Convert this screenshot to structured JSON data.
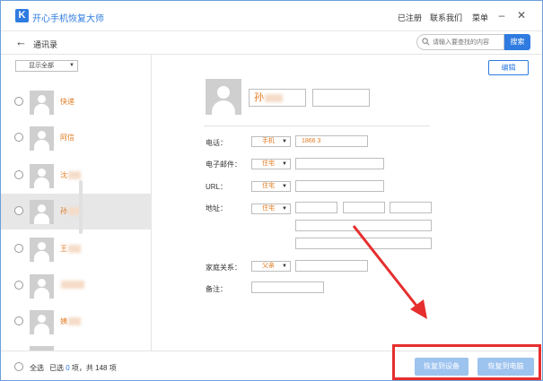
{
  "window": {
    "title": "开心手机恢复大师",
    "logo_letter": "K",
    "links": [
      "已注册",
      "联系我们",
      "菜单"
    ],
    "minimize": "–",
    "close": "✕"
  },
  "toolbar": {
    "back_icon": "←",
    "page_name": "通讯录",
    "search_placeholder": "请输入要查找的内容",
    "search_button": "搜索"
  },
  "left": {
    "filter": "显示全部",
    "contacts": [
      {
        "name": "快递",
        "selected": false
      },
      {
        "name": "阿信",
        "selected": false
      },
      {
        "name": "沈",
        "selected": false
      },
      {
        "name": "孙",
        "selected": true
      },
      {
        "name": "王",
        "selected": false
      },
      {
        "name": "",
        "selected": false
      },
      {
        "name": "姨",
        "selected": false
      }
    ]
  },
  "detail": {
    "edit_button": "编辑",
    "first_name": "孙",
    "phone_label": "电话：",
    "phone_type": "手机",
    "phone_value": "1866    3",
    "email_label": "电子邮件：",
    "email_type": "住宅",
    "url_label": "URL：",
    "url_type": "住宅",
    "address_label": "地址：",
    "address_type": "住宅",
    "family_label": "家庭关系：",
    "family_type": "父亲",
    "note_label": "备注："
  },
  "bottom": {
    "select_all": "全选",
    "selected_prefix": "已选",
    "selected_count": "0",
    "selected_suffix": "项，共 148 项",
    "restore_device": "恢复到设备",
    "restore_pc": "恢复到电脑"
  },
  "colors": {
    "accent": "#2f7be0",
    "name_text": "#e07a20",
    "highlight": "#e62e2e",
    "disabled_button": "#9dc3ef"
  }
}
